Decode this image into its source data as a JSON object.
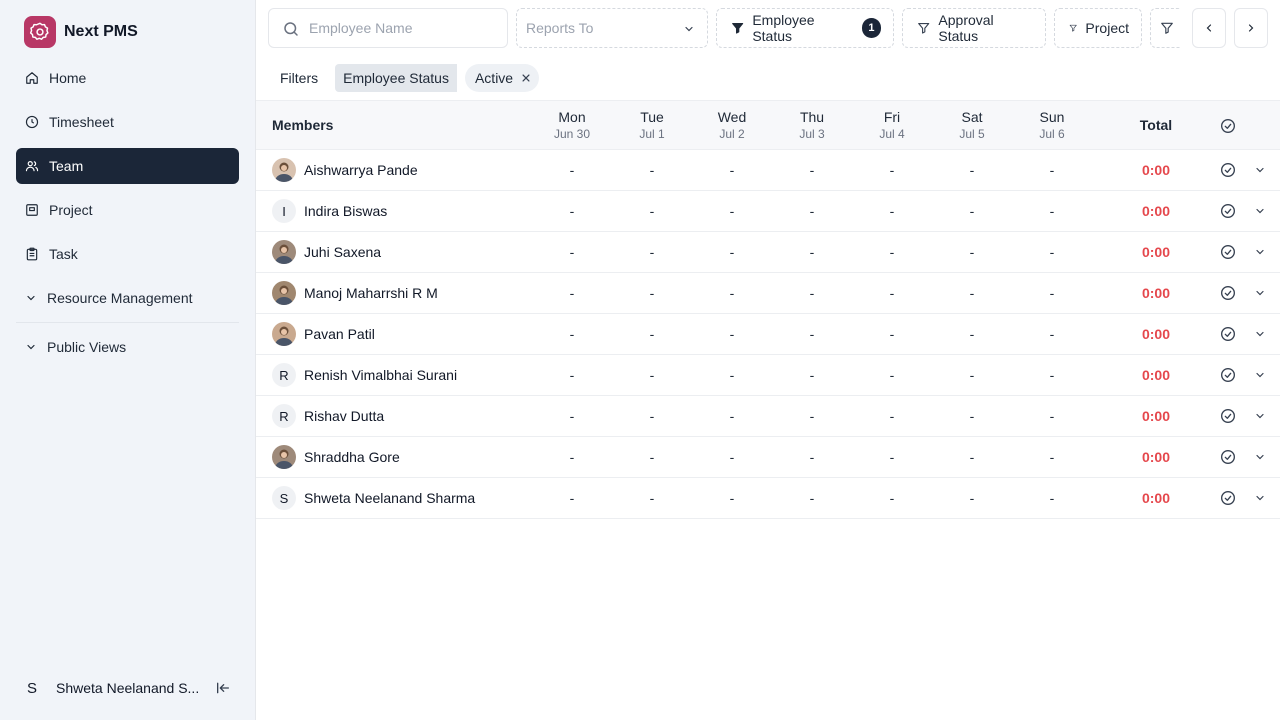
{
  "app": {
    "name": "Next PMS",
    "brand_color": "#b83766"
  },
  "sidebar": {
    "items": [
      {
        "label": "Home",
        "icon": "home-icon",
        "name": "sidebar-item-home",
        "active": false
      },
      {
        "label": "Timesheet",
        "icon": "clock-icon",
        "name": "sidebar-item-timesheet",
        "active": false
      },
      {
        "label": "Team",
        "icon": "users-icon",
        "name": "sidebar-item-team",
        "active": true
      },
      {
        "label": "Project",
        "icon": "folder-icon",
        "name": "sidebar-item-project",
        "active": false
      },
      {
        "label": "Task",
        "icon": "clipboard-icon",
        "name": "sidebar-item-task",
        "active": false
      }
    ],
    "groups": [
      {
        "label": "Resource Management"
      },
      {
        "label": "Public Views"
      }
    ],
    "user": {
      "initial": "S",
      "name": "Shweta Neelanand S..."
    }
  },
  "toolbar": {
    "search_placeholder": "Employee Name",
    "reports_to_placeholder": "Reports To",
    "employee_status_label": "Employee Status",
    "employee_status_count": "1",
    "approval_status_label": "Approval Status",
    "project_label": "Project"
  },
  "active_filters": {
    "label": "Filters",
    "key": "Employee Status",
    "value": "Active"
  },
  "table": {
    "members_header": "Members",
    "total_header": "Total",
    "days": [
      {
        "day": "Mon",
        "date": "Jun 30"
      },
      {
        "day": "Tue",
        "date": "Jul 1"
      },
      {
        "day": "Wed",
        "date": "Jul 2"
      },
      {
        "day": "Thu",
        "date": "Jul 3"
      },
      {
        "day": "Fri",
        "date": "Jul 4"
      },
      {
        "day": "Sat",
        "date": "Jul 5"
      },
      {
        "day": "Sun",
        "date": "Jul 6"
      }
    ],
    "rows": [
      {
        "name": "Aishwarrya Pande",
        "avatar": "photo",
        "initial": "",
        "cells": [
          "-",
          "-",
          "-",
          "-",
          "-",
          "-",
          "-"
        ],
        "total": "0:00"
      },
      {
        "name": "Indira Biswas",
        "avatar": "initial",
        "initial": "I",
        "cells": [
          "-",
          "-",
          "-",
          "-",
          "-",
          "-",
          "-"
        ],
        "total": "0:00"
      },
      {
        "name": "Juhi Saxena",
        "avatar": "photo",
        "initial": "",
        "cells": [
          "-",
          "-",
          "-",
          "-",
          "-",
          "-",
          "-"
        ],
        "total": "0:00"
      },
      {
        "name": "Manoj Maharrshi R M",
        "avatar": "photo",
        "initial": "",
        "cells": [
          "-",
          "-",
          "-",
          "-",
          "-",
          "-",
          "-"
        ],
        "total": "0:00"
      },
      {
        "name": "Pavan Patil",
        "avatar": "photo",
        "initial": "",
        "cells": [
          "-",
          "-",
          "-",
          "-",
          "-",
          "-",
          "-"
        ],
        "total": "0:00"
      },
      {
        "name": "Renish Vimalbhai Surani",
        "avatar": "initial",
        "initial": "R",
        "cells": [
          "-",
          "-",
          "-",
          "-",
          "-",
          "-",
          "-"
        ],
        "total": "0:00"
      },
      {
        "name": "Rishav Dutta",
        "avatar": "initial",
        "initial": "R",
        "cells": [
          "-",
          "-",
          "-",
          "-",
          "-",
          "-",
          "-"
        ],
        "total": "0:00"
      },
      {
        "name": "Shraddha Gore",
        "avatar": "photo",
        "initial": "",
        "cells": [
          "-",
          "-",
          "-",
          "-",
          "-",
          "-",
          "-"
        ],
        "total": "0:00"
      },
      {
        "name": "Shweta Neelanand Sharma",
        "avatar": "initial",
        "initial": "S",
        "cells": [
          "-",
          "-",
          "-",
          "-",
          "-",
          "-",
          "-"
        ],
        "total": "0:00"
      }
    ]
  },
  "colors": {
    "total_color": "#e5484d",
    "active_nav_bg": "#1b2638"
  }
}
